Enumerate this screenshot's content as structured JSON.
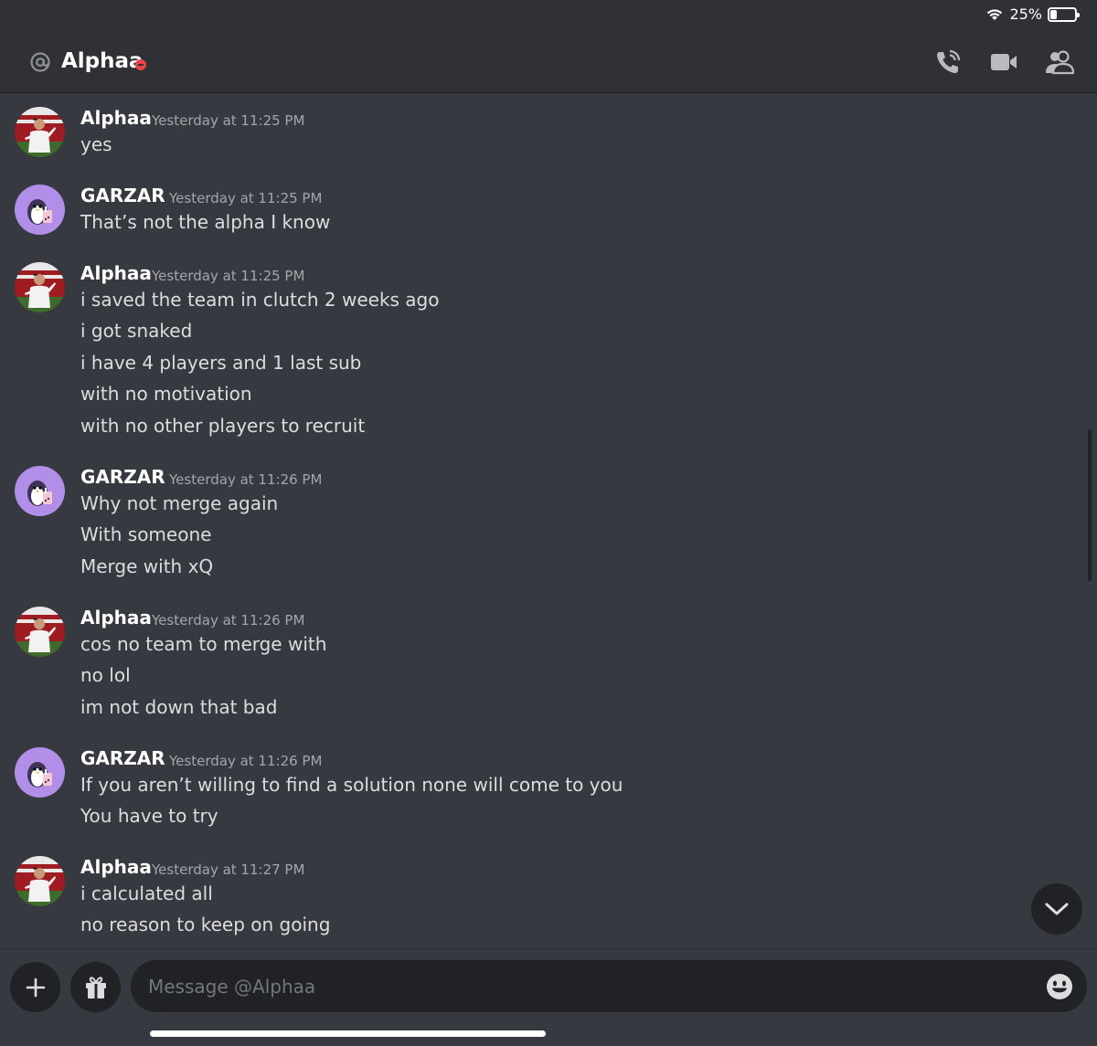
{
  "status_bar": {
    "battery_text": "25%",
    "battery_level": 0.25
  },
  "header": {
    "title": "Alphaa",
    "icons": [
      "at-icon",
      "dnd-status-icon",
      "phone-call-icon",
      "video-camera-icon",
      "members-icon"
    ]
  },
  "messages": [
    {
      "author": "Alphaa",
      "timestamp": "Yesterday at 11:25 PM",
      "avatar": "alphaa-avatar",
      "lines": [
        "yes"
      ]
    },
    {
      "author": "GARZAR",
      "timestamp": "Yesterday at 11:25 PM",
      "avatar": "garzar-avatar",
      "lines": [
        "That’s not the alpha I know"
      ]
    },
    {
      "author": "Alphaa",
      "timestamp": "Yesterday at 11:25 PM",
      "avatar": "alphaa-avatar",
      "lines": [
        "i saved the team in clutch 2 weeks ago",
        "i got snaked",
        "i have 4 players and 1 last sub",
        "with no motivation",
        "with no other players to recruit"
      ]
    },
    {
      "author": "GARZAR",
      "timestamp": "Yesterday at 11:26 PM",
      "avatar": "garzar-avatar",
      "lines": [
        "Why not merge again",
        "With someone",
        "Merge with xQ"
      ]
    },
    {
      "author": "Alphaa",
      "timestamp": "Yesterday at 11:26 PM",
      "avatar": "alphaa-avatar",
      "lines": [
        "cos no team to merge with",
        "no lol",
        "im not down that bad"
      ]
    },
    {
      "author": "GARZAR",
      "timestamp": "Yesterday at 11:26 PM",
      "avatar": "garzar-avatar",
      "lines": [
        "If you aren’t willing to find a solution none will come to you",
        "You have to try"
      ]
    },
    {
      "author": "Alphaa",
      "timestamp": "Yesterday at 11:27 PM",
      "avatar": "alphaa-avatar",
      "lines": [
        "i calculated all",
        "no reason to keep on going"
      ]
    }
  ],
  "composer": {
    "placeholder": "Message @Alphaa"
  },
  "colors": {
    "background": "#36393f",
    "header": "#2f3136",
    "input": "#202225",
    "dnd": "#ed4245",
    "garzar_avatar": "#b18ee8"
  }
}
